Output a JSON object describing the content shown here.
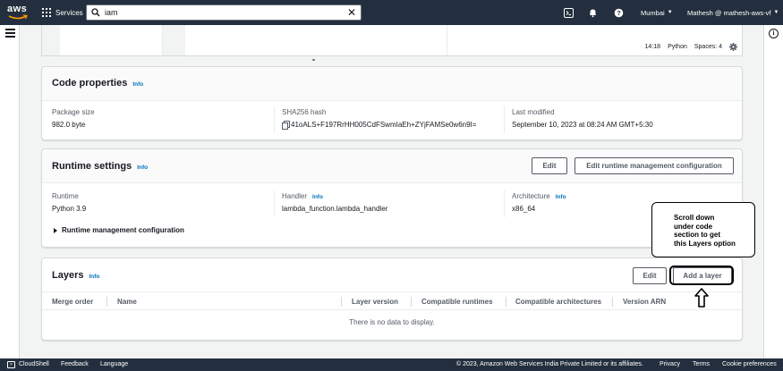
{
  "nav": {
    "logo": "aws",
    "services": "Services",
    "search_value": "iam",
    "region": "Mumbai",
    "account": "Mathesh @ mathesh-aws-vf",
    "icons": [
      "cloudshell-icon",
      "bell-icon",
      "help-icon"
    ]
  },
  "editor": {
    "cursor_pos": "14:18",
    "language": "Python",
    "spaces": "Spaces: 4"
  },
  "code_properties": {
    "title": "Code properties",
    "info": "Info",
    "package_size_label": "Package size",
    "package_size_value": "982.0 byte",
    "hash_label": "SHA256 hash",
    "hash_value": "41oALS+F197RrHH005CdFSwmIaEh+ZYjFAMSe0w6n9I=",
    "modified_label": "Last modified",
    "modified_value": "September 10, 2023 at 08:24 AM GMT+5:30"
  },
  "runtime_settings": {
    "title": "Runtime settings",
    "info": "Info",
    "edit_label": "Edit",
    "edit_config_label": "Edit runtime management configuration",
    "runtime_label": "Runtime",
    "runtime_value": "Python 3.9",
    "handler_label": "Handler",
    "handler_info": "Info",
    "handler_value": "lambda_function.lambda_handler",
    "arch_label": "Architecture",
    "arch_info": "Info",
    "arch_value": "x86_64",
    "expander_label": "Runtime management configuration"
  },
  "layers": {
    "title": "Layers",
    "info": "Info",
    "edit_label": "Edit",
    "add_label": "Add a layer",
    "columns": [
      "Merge order",
      "Name",
      "Layer version",
      "Compatible runtimes",
      "Compatible architectures",
      "Version ARN"
    ],
    "empty_text": "There is no data to display."
  },
  "annotation": {
    "line1": "Scroll down",
    "line2": "under code",
    "line3": "section to get",
    "line4": "this Layers option"
  },
  "footer": {
    "cloudshell": "CloudShell",
    "feedback": "Feedback",
    "language": "Language",
    "copyright": "© 2023, Amazon Web Services India Private Limited or its affiliates.",
    "privacy": "Privacy",
    "terms": "Terms",
    "cookies": "Cookie preferences"
  },
  "colors": {
    "nav_bg": "#232f3e",
    "link_blue": "#0073bb",
    "page_bg": "#f2f3f3"
  }
}
